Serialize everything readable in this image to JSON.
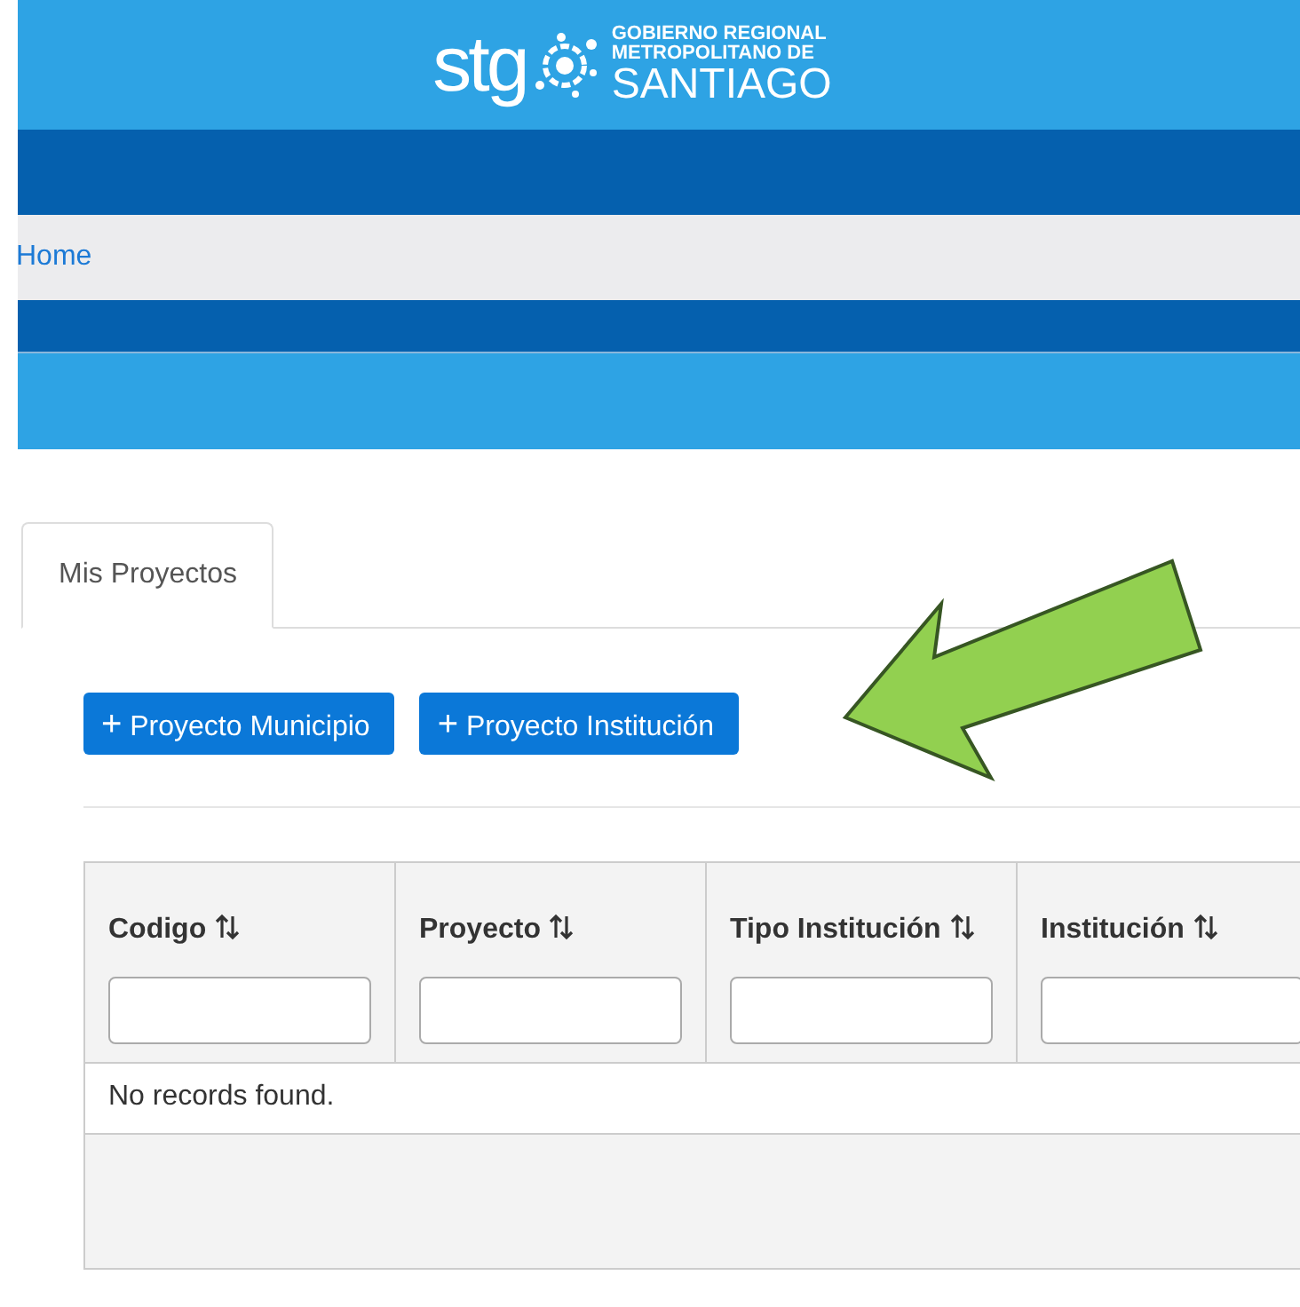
{
  "header": {
    "logo_mark": "stg",
    "logo_lines": [
      "GOBIERNO REGIONAL",
      "METROPOLITANO DE",
      "SANTIAGO"
    ]
  },
  "breadcrumb": {
    "label": "Home"
  },
  "tabs": [
    {
      "label": "Mis Proyectos",
      "selected": true
    }
  ],
  "buttons": [
    {
      "icon": "+",
      "label": "Proyecto Municipio"
    },
    {
      "icon": "+",
      "label": "Proyecto Institución"
    }
  ],
  "table": {
    "columns": [
      {
        "header": "Codigo"
      },
      {
        "header": "Proyecto"
      },
      {
        "header": "Tipo Institución"
      },
      {
        "header": "Institución"
      }
    ],
    "empty_message": "No records found."
  },
  "annotation": {
    "kind": "arrow"
  }
}
